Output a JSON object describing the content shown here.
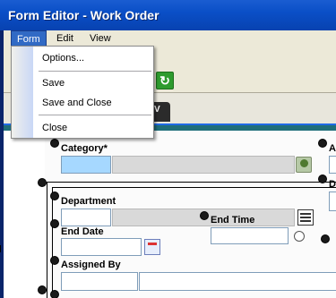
{
  "window": {
    "title": "Form Editor - Work Order"
  },
  "menubar": {
    "items": [
      {
        "label": "Form"
      },
      {
        "label": "Edit"
      },
      {
        "label": "View"
      }
    ]
  },
  "form_menu": {
    "items": [
      {
        "label": "Options..."
      },
      {
        "label": "Save"
      },
      {
        "label": "Save and Close"
      },
      {
        "label": "Close"
      }
    ]
  },
  "tab": {
    "label": "V"
  },
  "fields": {
    "category": {
      "label": "Category*"
    },
    "category_right_label": "A",
    "department": {
      "label": "Department"
    },
    "department_right_label": "D",
    "end_date": {
      "label": "End Date"
    },
    "end_time": {
      "label": "End Time"
    },
    "assigned_by": {
      "label": "Assigned By"
    }
  },
  "colors": {
    "titlebar": "#0a4fc7",
    "menu_highlight": "#316ac5",
    "required_field": "#a6d8ff",
    "selection_handle": "#1a1a1a"
  }
}
